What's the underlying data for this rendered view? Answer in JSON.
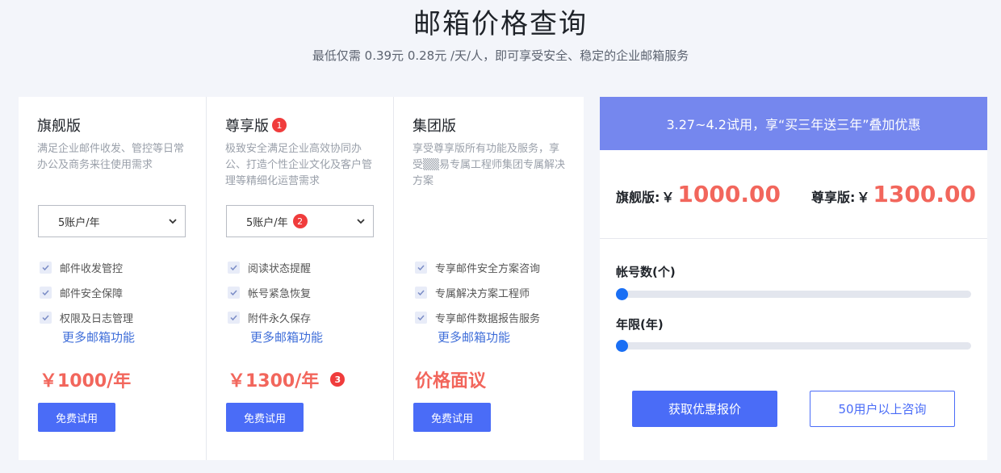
{
  "header": {
    "title": "邮箱价格查询",
    "subtitle": "最低仅需 0.39元 0.28元 /天/人，即可享受安全、稳定的企业邮箱服务"
  },
  "plans": [
    {
      "name": "旗舰版",
      "badge": "",
      "desc": "满足企业邮件收发、管控等日常办公及商务来往使用需求",
      "select_value": "5账户/年",
      "select_badge": "",
      "features": [
        "邮件收发管控",
        "邮件安全保障",
        "权限及日志管理"
      ],
      "more_label": "更多邮箱功能",
      "price": "￥1000/年",
      "price_badge": "",
      "try_label": "免费试用"
    },
    {
      "name": "尊享版",
      "badge": "1",
      "desc": "极致安全满足企业高效协同办公、打造个性企业文化及客户管理等精细化运营需求",
      "select_value": "5账户/年",
      "select_badge": "2",
      "features": [
        "阅读状态提醒",
        "帐号紧急恢复",
        "附件永久保存"
      ],
      "more_label": "更多邮箱功能",
      "price": "￥1300/年",
      "price_badge": "3",
      "try_label": "免费试用"
    },
    {
      "name": "集团版",
      "badge": "",
      "desc": "享受尊享版所有功能及服务，享受▒▒易专属工程师集团专属解决方案",
      "features": [
        "专享邮件安全方案咨询",
        "专属解决方案工程师",
        "专享邮件数据报告服务"
      ],
      "more_label": "更多邮箱功能",
      "price": "价格面议",
      "price_badge": "",
      "try_label": "免费试用"
    }
  ],
  "promo": {
    "banner": "3.27~4.2试用，享“买三年送三年”叠加优惠",
    "flagship_label": "旗舰版:",
    "flagship_currency": "￥",
    "flagship_price": "1000.00",
    "premium_label": "尊享版:",
    "premium_currency": "￥",
    "premium_price": "1300.00",
    "accounts_label": "帐号数(个)",
    "accounts_level": 0,
    "years_label": "年限(年)",
    "years_level": 0,
    "quote_button": "获取优惠报价",
    "consult_button": "50用户以上咨询"
  },
  "colors": {
    "accent": "#4a6cf7",
    "price": "#f2665c",
    "banner": "#7587ee",
    "badge": "#f03c3c",
    "link": "#3f6ed9"
  }
}
